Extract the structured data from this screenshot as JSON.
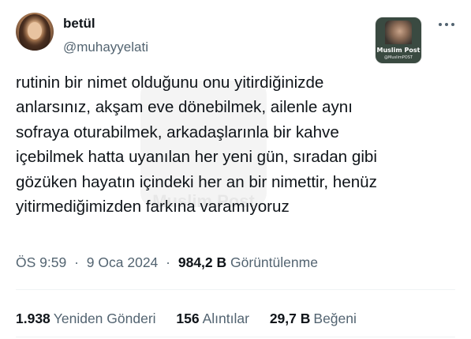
{
  "author": {
    "display_name": "betül",
    "handle": "@muhayyelati"
  },
  "overlay_logo": {
    "title": "Muslim Post",
    "subtitle": "@MuslimPOST",
    "watermark": "Muslim Post"
  },
  "tweet": {
    "lines": [
      "rutinin bir nimet olduğunu onu yitirdiğinizde",
      "anlarsınız, akşam eve dönebilmek, ailenle aynı",
      "sofraya oturabilmek, arkadaşlarınla bir kahve",
      "içebilmek hatta uyanılan her yeni gün, sıradan gibi",
      "gözüken hayatın içindeki her an bir nimettir, henüz",
      "yitirmediğimizden farkına varamıyoruz"
    ]
  },
  "meta": {
    "time": "ÖS 9:59",
    "separator": "·",
    "date": "9 Oca 2024",
    "views_count": "984,2 B",
    "views_label": "Görüntülenme"
  },
  "stats": {
    "retweets_count": "1.938",
    "retweets_label": "Yeniden Gönderi",
    "quotes_count": "156",
    "quotes_label": "Alıntılar",
    "likes_count": "29,7 B",
    "likes_label": "Beğeni"
  },
  "colors": {
    "text_primary": "#0f1419",
    "text_secondary": "#536471",
    "divider": "#eff3f4"
  }
}
